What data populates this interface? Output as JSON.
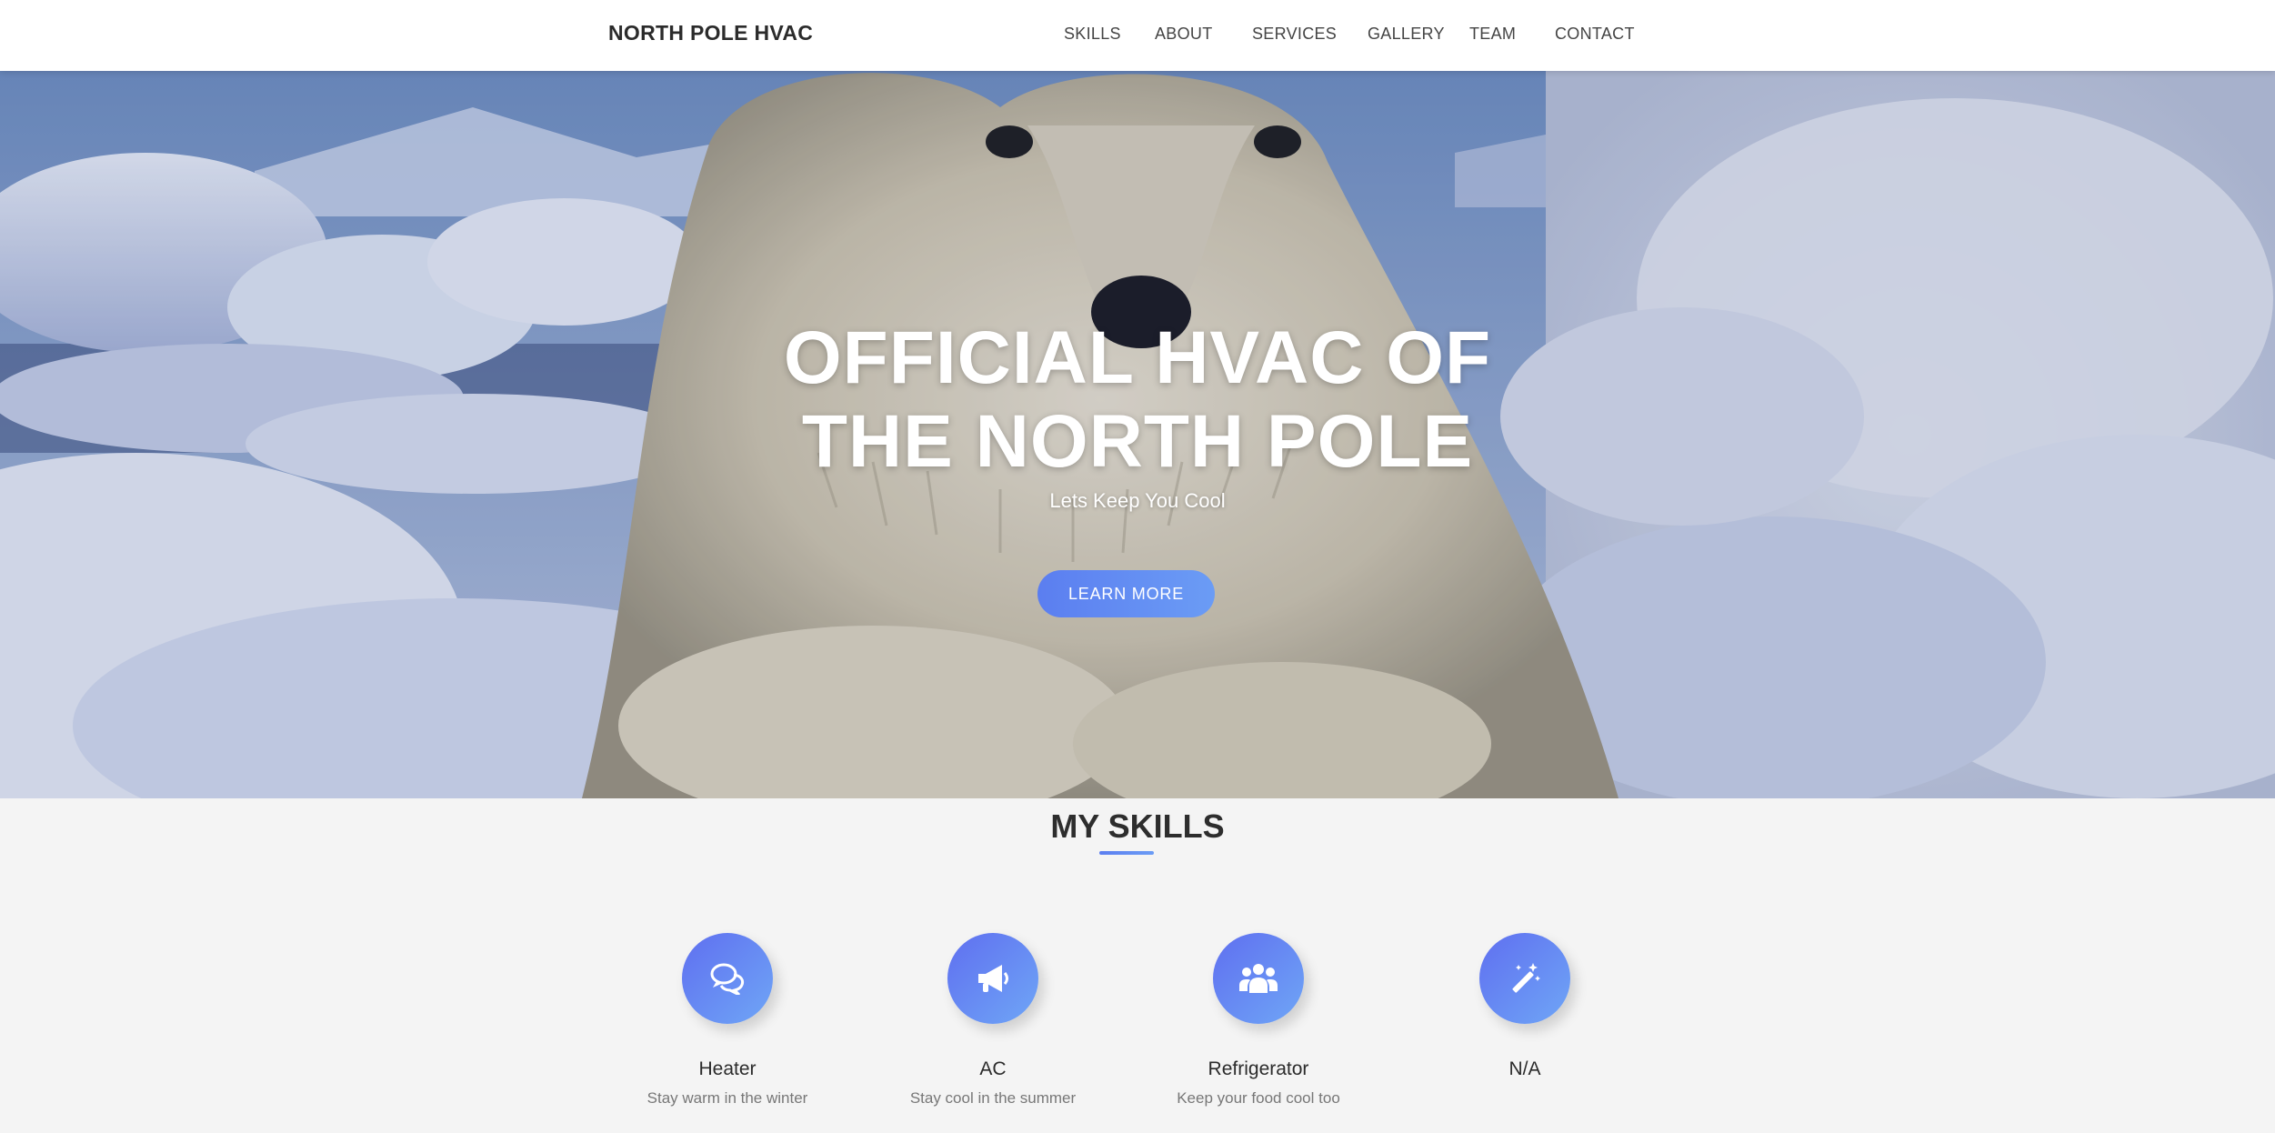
{
  "nav": {
    "brand": "NORTH POLE HVAC",
    "links": [
      "SKILLS",
      "ABOUT",
      "SERVICES",
      "GALLERY",
      "TEAM",
      "CONTACT"
    ]
  },
  "hero": {
    "title_line1": "OFFICIAL HVAC OF",
    "title_line2": "THE NORTH POLE",
    "subtitle": "Lets Keep You Cool",
    "button_label": "LEARN MORE"
  },
  "skills": {
    "title": "MY SKILLS",
    "items": [
      {
        "icon": "chat-bubbles-icon",
        "name": "Heater",
        "desc": "Stay warm in the winter"
      },
      {
        "icon": "megaphone-icon",
        "name": "AC",
        "desc": "Stay cool in the summer"
      },
      {
        "icon": "users-icon",
        "name": "Refrigerator",
        "desc": "Keep your food cool too"
      },
      {
        "icon": "magic-wand-icon",
        "name": "N/A",
        "desc": ""
      }
    ]
  },
  "colors": {
    "accent_start": "#5b7ef0",
    "accent_end": "#6b9cf5",
    "section_bg": "#f4f4f4"
  }
}
